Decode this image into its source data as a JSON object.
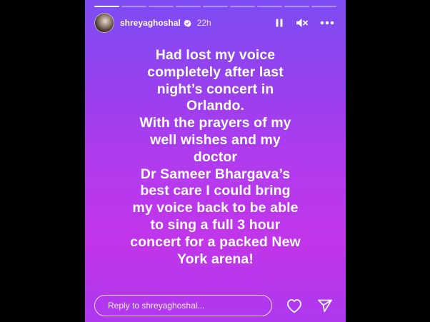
{
  "story": {
    "username": "shreyaghoshal",
    "time_ago": "22h",
    "progress": {
      "total_segments": 9,
      "completed_segments": 1
    },
    "message_lines": [
      "Had lost my voice",
      "completely after last",
      "night’s concert in",
      "Orlando.",
      "With the prayers of my",
      "well wishes and my",
      "doctor",
      "Dr Sameer Bhargava’s",
      "best care I could bring",
      "my voice back to be able",
      "to sing a full 3 hour",
      "concert for a packed New",
      "York arena!"
    ]
  },
  "icons": {
    "verified": "verified-badge-icon",
    "pause": "pause-icon",
    "mute": "speaker-muted-icon",
    "more": "more-options-icon",
    "like": "heart-icon",
    "share": "send-icon"
  },
  "reply": {
    "placeholder": "Reply to shreyaghoshal..."
  },
  "colors": {
    "gradient_top": "#7d4cf2",
    "gradient_bottom": "#c235ea",
    "text": "#ffffff"
  }
}
